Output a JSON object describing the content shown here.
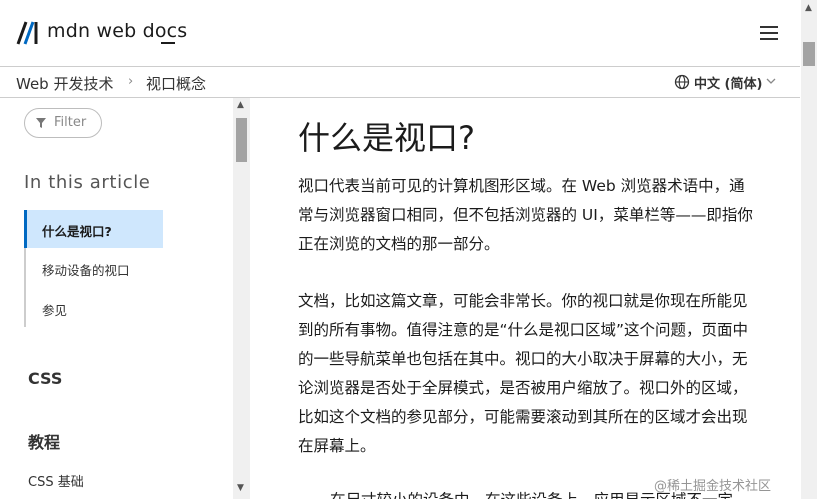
{
  "header": {
    "logo_text": "mdn web docs",
    "logo_icon": "mdn-m-logo",
    "menu_icon": "hamburger-menu-icon"
  },
  "breadcrumb": {
    "items": [
      "Web 开发技术",
      "视口概念"
    ],
    "separator": "›"
  },
  "language": {
    "label": "中文 (简体)",
    "icon": "globe-icon"
  },
  "sidebar": {
    "filter_placeholder": "Filter",
    "toc_heading": "In this article",
    "toc_items": [
      "什么是视口?",
      "移动设备的视口",
      "参见"
    ],
    "groups": [
      "CSS",
      "教程"
    ],
    "links": [
      "CSS 基础"
    ]
  },
  "main": {
    "title": "什么是视口?",
    "paragraphs": [
      "视口代表当前可见的计算机图形区域。在 Web 浏览器术语中，通常与浏览器窗口相同，但不包括浏览器的 UI，菜单栏等——即指你正在浏览的文档的那一部分。",
      "文档，比如这篇文章，可能会非常长。你的视口就是你现在所能见到的所有事物。值得注意的是“什么是视口区域”这个问题，页面中的一些导航菜单也包括在其中。视口的大小取决于屏幕的大小，无论浏览器是否处于全屏模式，是否被用户缩放了。视口外的区域，比如这个文档的参见部分，可能需要滚动到其所在的区域才会出现在屏幕上。",
      "在尺寸较小的设备中，在这些设备上，应用显示区域不一定"
    ]
  },
  "watermark": "@稀土掘金技术社区",
  "colors": {
    "accent": "#0069c2",
    "toc_active_bg": "#cfe7fd",
    "border": "#cdcdcd"
  }
}
